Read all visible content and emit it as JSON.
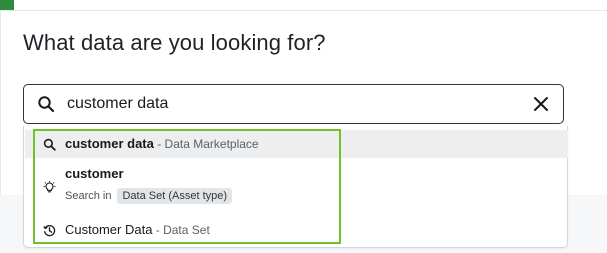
{
  "page": {
    "title": "What data are you looking for?"
  },
  "search": {
    "value": "customer data",
    "placeholder": "",
    "search_icon": "search-icon",
    "clear_icon": "close-icon"
  },
  "dropdown": {
    "suggestion": {
      "icon": "search-icon",
      "term": "customer data",
      "separator": " - ",
      "scope": "Data Marketplace"
    },
    "search_in": {
      "icon": "lightbulb-icon",
      "term": "customer",
      "prefix": "Search in",
      "chip": "Data Set (Asset type)"
    },
    "recent": {
      "icon": "history-icon",
      "term": "Customer Data",
      "separator": " - ",
      "type": "Data Set"
    }
  },
  "colors": {
    "highlight": "#72c02c",
    "selected_row_bg": "#eceef0",
    "chip_bg": "#e3e6e9"
  }
}
